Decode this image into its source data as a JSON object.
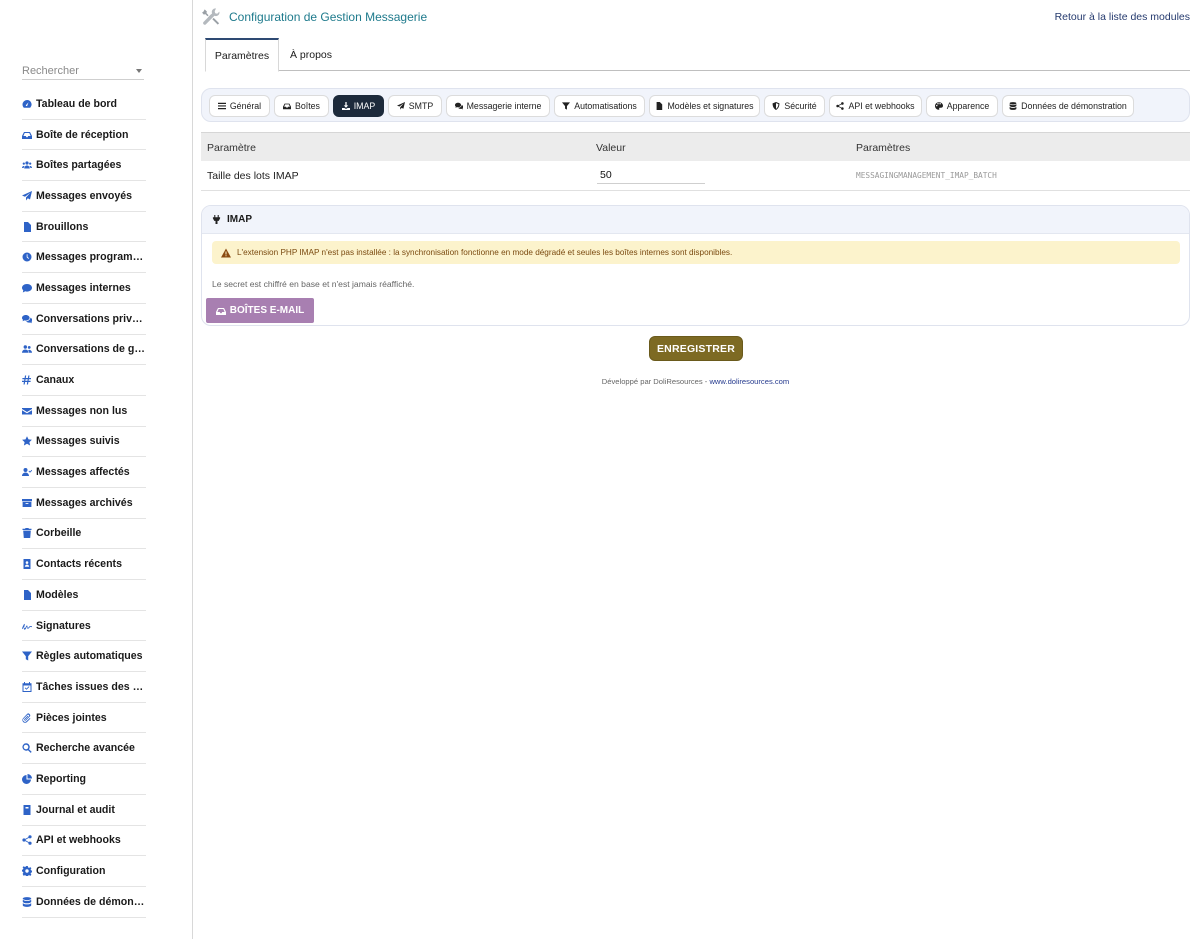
{
  "header": {
    "title": "Configuration de Gestion Messagerie",
    "back_link": "Retour à la liste des modules"
  },
  "sidebar": {
    "search_placeholder": "Rechercher",
    "items": [
      {
        "label": "Tableau de bord",
        "icon": "dashboard-icon"
      },
      {
        "label": "Boîte de réception",
        "icon": "inbox-icon"
      },
      {
        "label": "Boîtes partagées",
        "icon": "users-icon"
      },
      {
        "label": "Messages envoyés",
        "icon": "paper-plane-icon"
      },
      {
        "label": "Brouillons",
        "icon": "file-icon"
      },
      {
        "label": "Messages programm…",
        "icon": "clock-icon"
      },
      {
        "label": "Messages internes",
        "icon": "comment-icon"
      },
      {
        "label": "Conversations privées",
        "icon": "comments-icon"
      },
      {
        "label": "Conversations de gr…",
        "icon": "user-group-icon"
      },
      {
        "label": "Canaux",
        "icon": "hashtag-icon"
      },
      {
        "label": "Messages non lus",
        "icon": "envelope-icon"
      },
      {
        "label": "Messages suivis",
        "icon": "star-icon"
      },
      {
        "label": "Messages affectés",
        "icon": "user-check-icon"
      },
      {
        "label": "Messages archivés",
        "icon": "archive-icon"
      },
      {
        "label": "Corbeille",
        "icon": "trash-icon"
      },
      {
        "label": "Contacts récents",
        "icon": "contact-book-icon"
      },
      {
        "label": "Modèles",
        "icon": "file-lines-icon"
      },
      {
        "label": "Signatures",
        "icon": "signature-icon"
      },
      {
        "label": "Règles automatiques",
        "icon": "filter-icon"
      },
      {
        "label": "Tâches issues des …",
        "icon": "calendar-check-icon"
      },
      {
        "label": "Pièces jointes",
        "icon": "paperclip-icon"
      },
      {
        "label": "Recherche avancée",
        "icon": "magnifier-icon"
      },
      {
        "label": "Reporting",
        "icon": "pie-chart-icon"
      },
      {
        "label": "Journal et audit",
        "icon": "journal-icon"
      },
      {
        "label": "API et webhooks",
        "icon": "share-nodes-icon"
      },
      {
        "label": "Configuration",
        "icon": "gear-icon"
      },
      {
        "label": "Données de démons…",
        "icon": "database-icon"
      }
    ]
  },
  "tabs": [
    {
      "label": "Paramètres",
      "active": true
    },
    {
      "label": "À propos",
      "active": false
    }
  ],
  "subtabs": [
    {
      "label": "Général",
      "icon": "bars-icon"
    },
    {
      "label": "Boîtes",
      "icon": "inbox-icon"
    },
    {
      "label": "IMAP",
      "icon": "download-icon",
      "active": true
    },
    {
      "label": "SMTP",
      "icon": "paper-plane-icon"
    },
    {
      "label": "Messagerie interne",
      "icon": "comments-icon"
    },
    {
      "label": "Automatisations",
      "icon": "filter-icon"
    },
    {
      "label": "Modèles et signatures",
      "icon": "file-icon"
    },
    {
      "label": "Sécurité",
      "icon": "shield-icon"
    },
    {
      "label": "API et webhooks",
      "icon": "share-nodes-icon"
    },
    {
      "label": "Apparence",
      "icon": "palette-icon"
    },
    {
      "label": "Données de démonstration",
      "icon": "database-icon"
    }
  ],
  "table": {
    "headers": [
      "Paramètre",
      "Valeur",
      "Paramètres"
    ],
    "rows": [
      {
        "name": "Taille des lots IMAP",
        "value": "50",
        "key": "MESSAGINGMANAGEMENT_IMAP_BATCH"
      }
    ]
  },
  "panel": {
    "title": "IMAP",
    "warning": "L'extension PHP IMAP n'est pas installée : la synchronisation fonctionne en mode dégradé et seules les boîtes internes sont disponibles.",
    "note": "Le secret est chiffré en base et n'est jamais réaffiché.",
    "button": "BOÎTES E-MAIL"
  },
  "save_button": "ENREGISTRER",
  "footer": {
    "text": "Développé par DoliResources - ",
    "link": "www.doliresources.com"
  },
  "colors": {
    "accent_dark": "#1d2a3b",
    "sidebar_icon": "#2e63c7",
    "save": "#7d6a23",
    "mailbox_button": "#a87fb1",
    "warning_bg": "#fcf3cc",
    "title": "#1e7a8c"
  }
}
